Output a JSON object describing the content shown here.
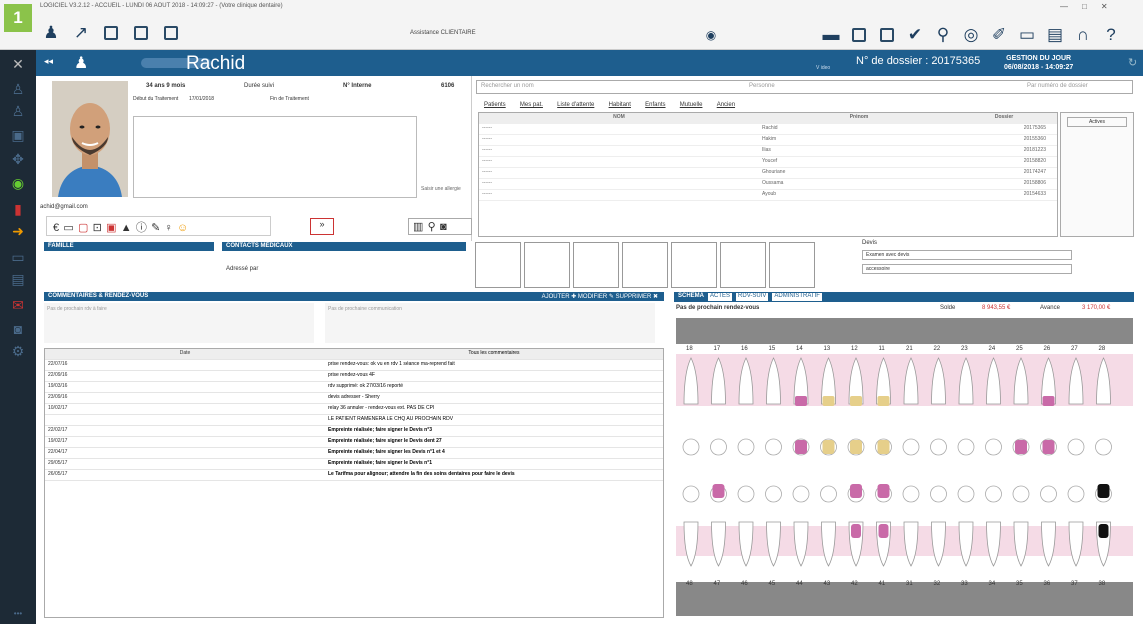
{
  "titlebar": {
    "title": "LOGICIEL V3.2.12 - ACCUEIL - LUNDI 06 AOUT 2018 - 14:09:27 - (Votre clinique dentaire)",
    "assistant": "Assistance CLIENTAIRE",
    "badge": "1",
    "window_controls": [
      "—",
      "□",
      "✕"
    ]
  },
  "header": {
    "patient_name": "Rachid",
    "dossier": "N° de dossier : 20175365",
    "gestion_label": "GESTION DU JOUR",
    "gestion_date": "06/08/2018 - 14:09:27",
    "logo_sub": "V ideo"
  },
  "patient": {
    "age": "34 ans 9 mois",
    "duration": "Durée suivi",
    "n_interne_label": "N° Interne",
    "n_interne": "6106",
    "debut_label": "Début du Traitement",
    "debut": "17/01/2018",
    "fin_label": "Fin de Traitement",
    "email": "achid@gmail.com",
    "allergie": "Saisir une allergie"
  },
  "search": {
    "name_placeholder": "Rechercher un nom",
    "person_placeholder": "Personne",
    "dossier_placeholder": "Par numéro de dossier"
  },
  "patient_tabs": [
    "Patients",
    "Mes pat.",
    "Liste d'attente",
    "Habitant",
    "Enfants",
    "Mutuelle",
    "Ancien"
  ],
  "patient_table": {
    "headers": [
      "NOM",
      "Prénom",
      "Dossier"
    ],
    "rows": [
      [
        "------",
        "Rachid",
        "20175365"
      ],
      [
        "------",
        "Hakim",
        "20155360"
      ],
      [
        "------",
        "Ilias",
        "20181223"
      ],
      [
        "------",
        "Youcef",
        "20158820"
      ],
      [
        "------",
        "Ghouriane",
        "20174247"
      ],
      [
        "------",
        "Oussama",
        "20158806"
      ],
      [
        "------",
        "Ayoub",
        "20154633"
      ]
    ],
    "right_btn": "Actives"
  },
  "sections": {
    "famille": "FAMILLE",
    "contacts": "CONTACTS MÉDICAUX",
    "adresse": "Adressé par",
    "comments": "COMMENTAIRES & RENDEZ-VOUS",
    "comment_actions": "AJOUTER ✚   MODIFIER ✎   SUPPRIMER ✖"
  },
  "devis": {
    "label": "Devis",
    "option1": "Examen avec devis",
    "option2": "accessoire"
  },
  "comments": {
    "prev_rdv": "Pas de prochain rdv à faire",
    "next_rdv": "Pas de prochaine communication",
    "date_header": "Date",
    "text_header": "Tous les commentaires",
    "rows": [
      [
        "22/07/16",
        "prise rendez-vous: ok vu en rdv 1 séance ma-reprend fait"
      ],
      [
        "22/09/16",
        "prise rendez-vous 4F"
      ],
      [
        "19/03/16",
        "rdv supprimé: ok 27/03/16 reporté"
      ],
      [
        "23/09/16",
        "devis adresser - Sherry"
      ],
      [
        "10/02/17",
        "relay 36 annuler - rendez-vous ext. PAS DE CPI"
      ],
      [
        "",
        "LE PATIENT RAMENERA LE CHQ AU PROCHAIN RDV"
      ],
      [
        "22/02/17",
        "Empreinte réalisée; faire signer le Devis n°3"
      ],
      [
        "19/02/17",
        "Empreinte réalisée; faire signer le Devis dent 27"
      ],
      [
        "22/04/17",
        "Empreinte réalisée; faire signer les Devis n°1 et 4"
      ],
      [
        "29/05/17",
        "Empreinte réalisée; faire signer le Devis n°1"
      ],
      [
        "26/05/17",
        "Le Tarifma pour alignour; attendre la fin des soins dentaires pour faire le devis"
      ]
    ]
  },
  "dental": {
    "tabs": [
      "SCHEMA",
      "ACTES",
      "RDV-SUIV",
      "ADMINISTRATIF"
    ],
    "next_rdv": "Pas de prochain rendez-vous",
    "solde_label": "Solde",
    "solde": "8 943,55 €",
    "avance_label": "Avance",
    "avance": "3 170,00 €",
    "upper_numbers": [
      "18",
      "17",
      "16",
      "15",
      "14",
      "13",
      "12",
      "11",
      "21",
      "22",
      "23",
      "24",
      "25",
      "26",
      "27",
      "28"
    ],
    "lower_numbers": [
      "48",
      "47",
      "46",
      "45",
      "44",
      "43",
      "42",
      "41",
      "31",
      "32",
      "33",
      "34",
      "35",
      "36",
      "37",
      "38"
    ]
  },
  "colors": {
    "header": "#1e5e8e",
    "sidebar": "#1d2a36",
    "badge": "#8bc34a",
    "pink": "#c96aa8",
    "gold": "#e6cf8a"
  }
}
